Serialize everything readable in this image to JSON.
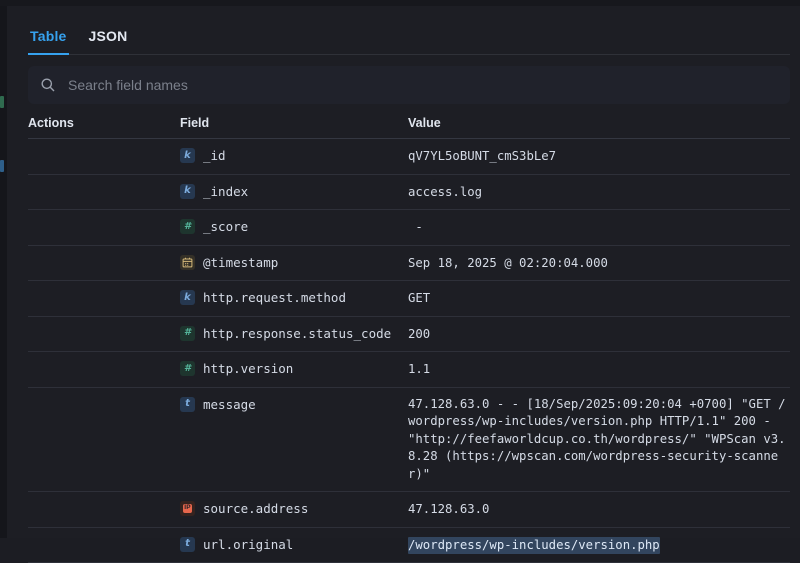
{
  "tabs": [
    {
      "label": "Table",
      "active": true
    },
    {
      "label": "JSON",
      "active": false
    }
  ],
  "search": {
    "placeholder": "Search field names"
  },
  "table": {
    "headers": {
      "actions": "Actions",
      "field": "Field",
      "value": "Value"
    },
    "rows": [
      {
        "field": "_id",
        "type": "keyword",
        "value": "qV7YL5oBUNT_cmS3bLe7"
      },
      {
        "field": "_index",
        "type": "keyword",
        "value": "access.log"
      },
      {
        "field": "_score",
        "type": "number",
        "value": " - "
      },
      {
        "field": "@timestamp",
        "type": "date",
        "value": "Sep 18, 2025 @ 02:20:04.000"
      },
      {
        "field": "http.request.method",
        "type": "keyword",
        "value": "GET"
      },
      {
        "field": "http.response.status_code",
        "type": "number",
        "value": "200"
      },
      {
        "field": "http.version",
        "type": "number",
        "value": "1.1"
      },
      {
        "field": "message",
        "type": "text",
        "value": "47.128.63.0 - - [18/Sep/2025:09:20:04 +0700] \"GET /wordpress/wp-includes/version.php HTTP/1.1\" 200 - \"http://feefaworldcup.co.th/wordpress/\" \"WPScan v3.8.28 (https://wpscan.com/wordpress-security-scanner)\""
      },
      {
        "field": "source.address",
        "type": "ip",
        "value": "47.128.63.0"
      },
      {
        "field": "url.original",
        "type": "text",
        "value": "/wordpress/wp-includes/version.php",
        "highlighted": true
      }
    ]
  },
  "colors": {
    "accent": "#36a2ef",
    "highlight_bg": "#32455e",
    "token_keyword": "#7cabdc",
    "token_number": "#54b399",
    "token_text": "#7cabdc",
    "token_date": "#d3b878",
    "token_ip": "#e7664c"
  }
}
